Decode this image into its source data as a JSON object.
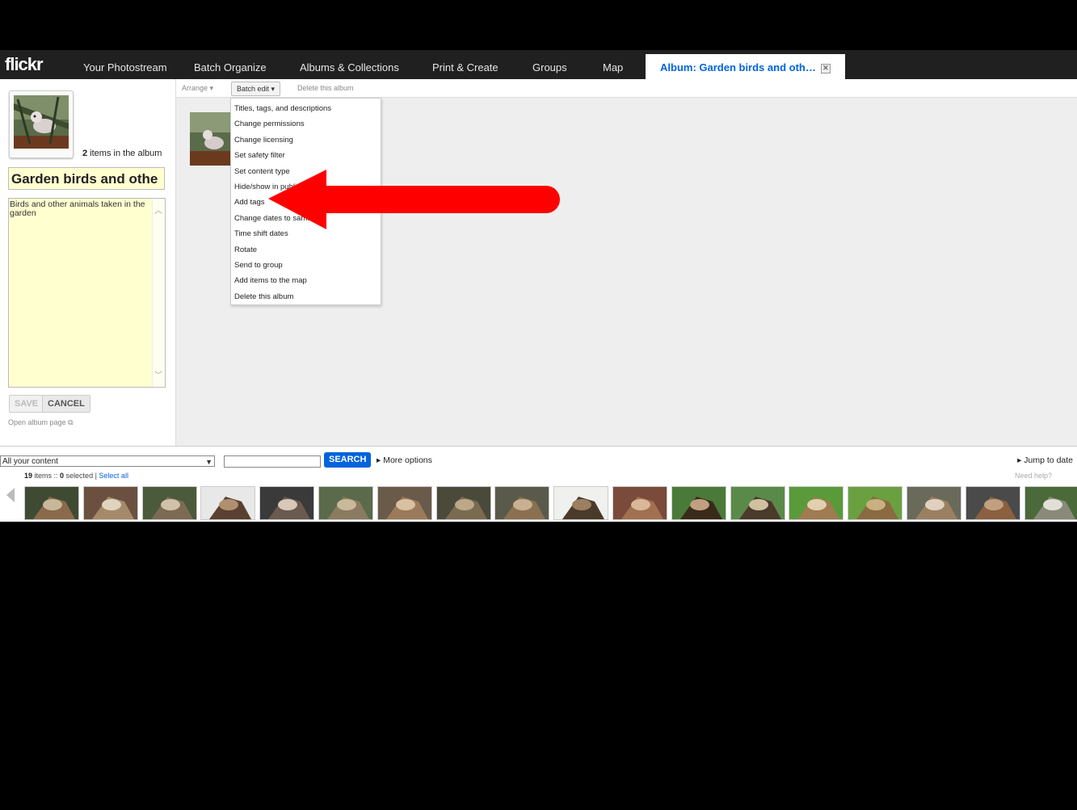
{
  "nav": {
    "logo": "flickr",
    "tabs": [
      "Your Photostream",
      "Batch Organize",
      "Albums & Collections",
      "Print & Create",
      "Groups",
      "Map"
    ],
    "active_tab": "Album: Garden birds and oth…",
    "close_glyph": "✕"
  },
  "album": {
    "item_count": "2",
    "item_count_suffix": " items in the album",
    "title": "Garden birds and othe",
    "description": "Birds and other animals taken in the garden",
    "save_label": "SAVE",
    "cancel_label": "CANCEL",
    "open_link": "Open album page"
  },
  "toolbar": {
    "arrange": "Arrange",
    "batch_edit": "Batch edit",
    "delete": "Delete this album"
  },
  "batch_menu": [
    "Titles, tags, and descriptions",
    "Change permissions",
    "Change licensing",
    "Set safety filter",
    "Set content type",
    "Hide/show in public",
    "Add tags",
    "Change dates to same",
    "Time shift dates",
    "Rotate",
    "Send to group",
    "Add items to the map",
    "Delete this album"
  ],
  "bottom": {
    "filter_selected": "All your content",
    "search_value": "",
    "search_label": "SEARCH",
    "more_options": "More options",
    "jump_to_date": "Jump to date",
    "items_count": "19",
    "items_text": " items :: ",
    "selected_count": "0",
    "selected_text": " selected | ",
    "select_all": "Select all",
    "need_help": "Need help?"
  },
  "colors": {
    "accent": "#0063dc",
    "nav_bg": "#202020",
    "arrow": "#ff0000",
    "title_bg": "#ffffd0"
  }
}
